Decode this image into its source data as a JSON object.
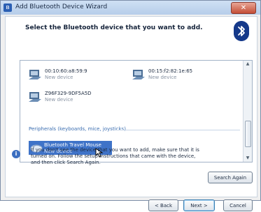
{
  "window": {
    "title": "Add Bluetooth Device Wizard",
    "close_glyph": "✕"
  },
  "heading": "Select the Bluetooth device that you want to add.",
  "devices": [
    {
      "name": "00:10:60:a8:59:9",
      "status": "New device",
      "icon": "computer-icon"
    },
    {
      "name": "00:15:f2:82:1e:65",
      "status": "New device",
      "icon": "computer-icon"
    },
    {
      "name": "Z96F329-9DF5A5D",
      "status": "New device",
      "icon": "computer-icon"
    }
  ],
  "category_label": "Peripherals (keyboards, mice, joysticks)",
  "selected_device": {
    "name": "Bluetooth Travel Mouse",
    "status": "New device",
    "icon": "mouse-icon"
  },
  "info": {
    "icon": "info-icon",
    "glyph": "i",
    "text": "If you don't see the device that you want to add, make sure that it is turned on. Follow the setup instructions that came with the device, and then click Search Again."
  },
  "buttons": {
    "search_again": "Search Again",
    "back": "< Back",
    "next": "Next >",
    "cancel": "Cancel"
  },
  "scrollbar": {
    "up": "▲",
    "down": "▼"
  },
  "colors": {
    "selection": "#3f73c8",
    "accent": "#15398a",
    "category": "#3a6db0"
  }
}
